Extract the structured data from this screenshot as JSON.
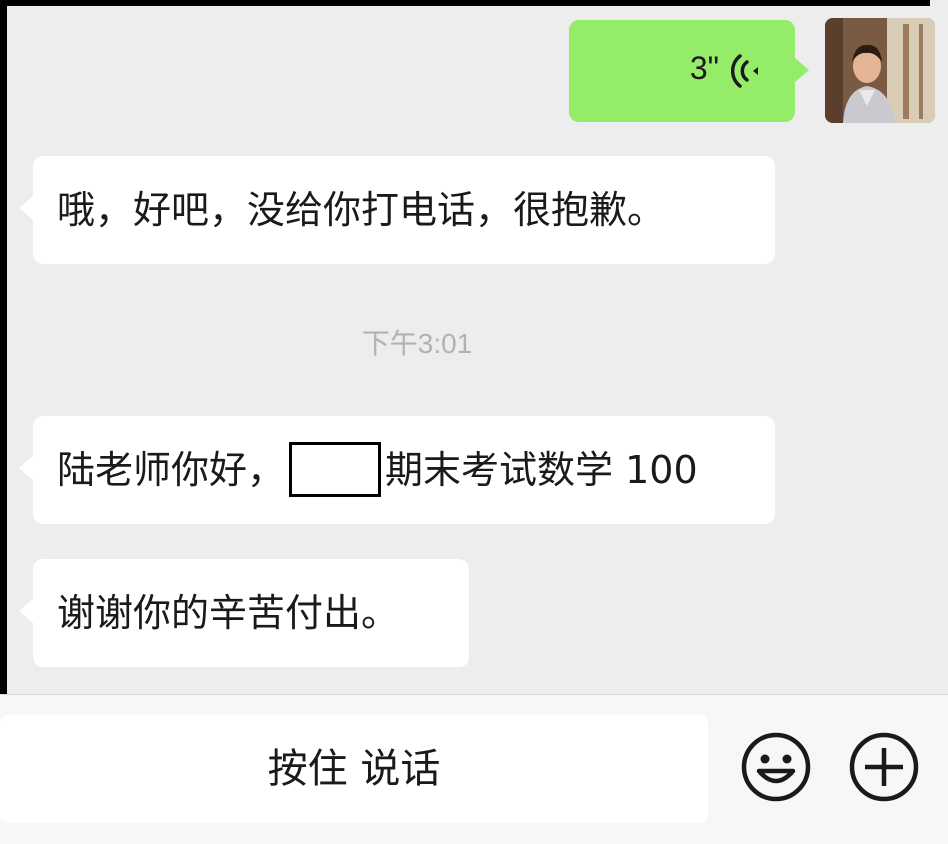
{
  "messages": {
    "voice": {
      "duration": "3\"",
      "icon": "voice-wave-icon"
    },
    "incoming_1": "哦，好吧，没给你打电话，很抱歉。",
    "timestamp": "下午3:01",
    "incoming_2_before": "陆老师你好，",
    "incoming_2_after": "期末考试数学 100",
    "incoming_3": "谢谢你的辛苦付出。"
  },
  "input_bar": {
    "hold_to_talk_label": "按住 说话",
    "emoji_icon": "smiley-icon",
    "plus_icon": "plus-circle-icon"
  },
  "colors": {
    "chat_background": "#ededed",
    "outgoing_bubble": "#95ec69",
    "incoming_bubble": "#ffffff",
    "timestamp_text": "#b2b2b2"
  }
}
